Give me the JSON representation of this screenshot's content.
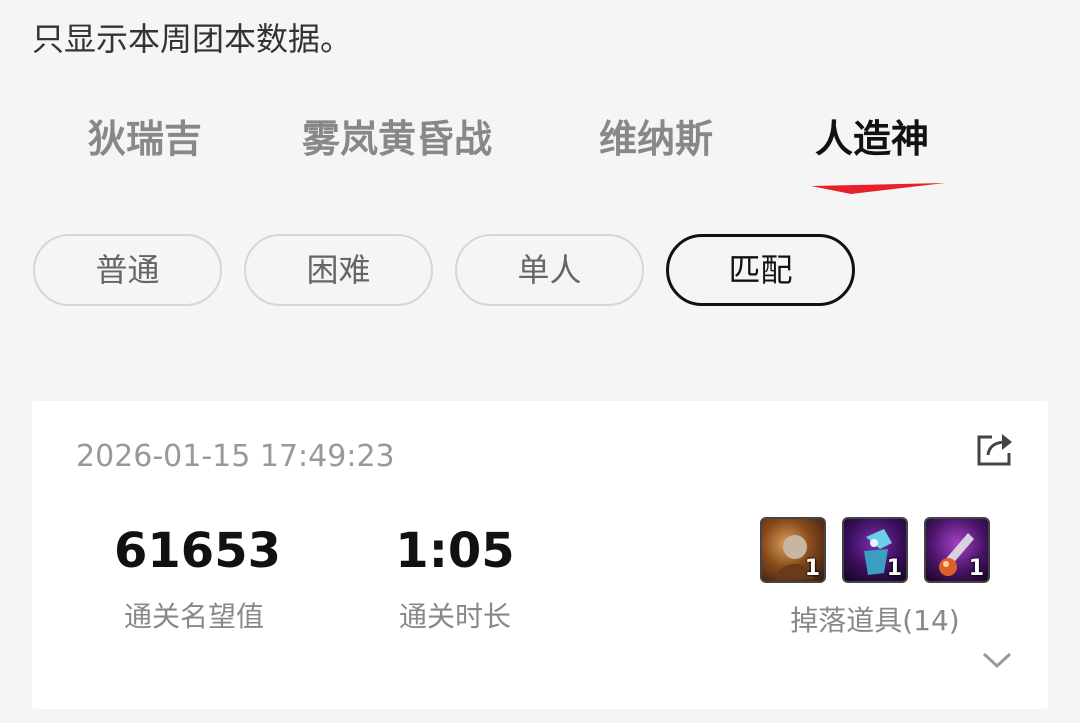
{
  "notice": "只显示本周团本数据。",
  "tabs": [
    {
      "label": "狄瑞吉",
      "active": false
    },
    {
      "label": "雾岚黄昏战",
      "active": false
    },
    {
      "label": "维纳斯",
      "active": false
    },
    {
      "label": "人造神",
      "active": true
    }
  ],
  "accent_color": "#e8202a",
  "modes": [
    {
      "label": "普通",
      "active": false
    },
    {
      "label": "困难",
      "active": false
    },
    {
      "label": "单人",
      "active": false
    },
    {
      "label": "匹配",
      "active": true
    }
  ],
  "record": {
    "time": "2026-01-15 17:49:23",
    "fame_value": "61653",
    "fame_label": "通关名望值",
    "duration_value": "1:05",
    "duration_label": "通关时长",
    "drops_label": "掉落道具(14)",
    "drop_items": [
      {
        "icon": "warrior-item-icon",
        "count": "1"
      },
      {
        "icon": "blue-armor-item-icon",
        "count": "1"
      },
      {
        "icon": "purple-orb-item-icon",
        "count": "1"
      }
    ]
  }
}
